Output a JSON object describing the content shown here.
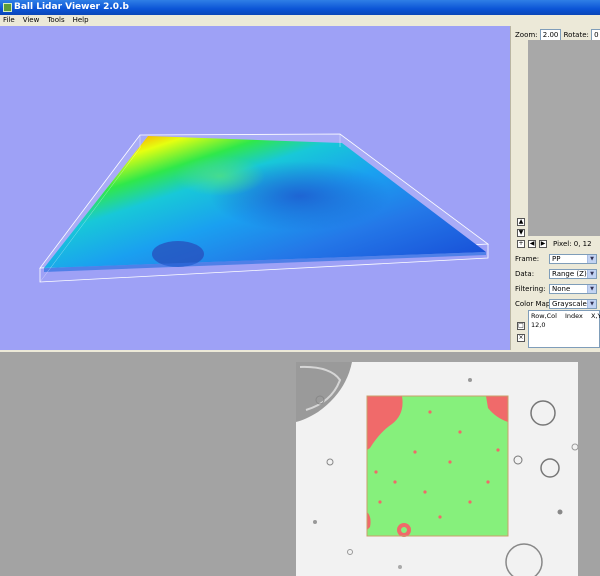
{
  "window": {
    "title": "Ball Lidar Viewer 2.0.b",
    "menu": [
      "File",
      "View",
      "Tools",
      "Help"
    ]
  },
  "panel": {
    "zoom_label": "Zoom:",
    "zoom_value": "2.00",
    "rotate_label": "Rotate:",
    "rotate_value": "0",
    "pixel_text": "Pixel: 0, 12",
    "frame_label": "Frame:",
    "frame_value": "PP",
    "data_label": "Data:",
    "data_value": "Range (Z)",
    "filtering_label": "Filtering:",
    "filtering_value": "None",
    "colormap_label": "Color Map:",
    "colormap_value": "Grayscale",
    "list_headers": [
      "Row,Col",
      "Index",
      "X,Y"
    ],
    "list_rows": [
      [
        "12,0"
      ]
    ]
  },
  "colors": {
    "viewport_bg": "#9ea1f6",
    "mask_green": "#86f07c",
    "mask_red": "#f06a6a",
    "window_bg": "#ece9d8"
  },
  "icons": [
    "app-icon",
    "up-arrow-icon",
    "down-arrow-icon",
    "plus-icon",
    "left-arrow-icon",
    "right-arrow-icon",
    "dropdown-arrow-icon",
    "add-icon",
    "remove-icon"
  ]
}
